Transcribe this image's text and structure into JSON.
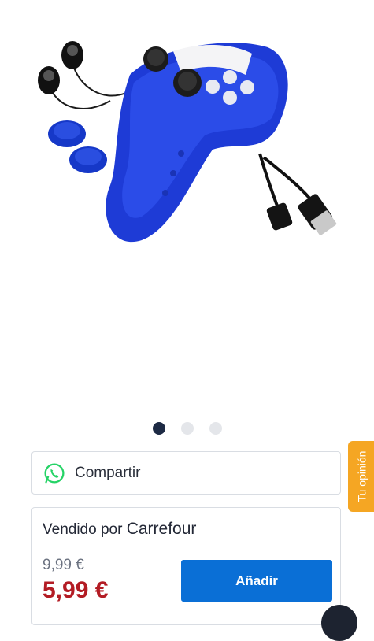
{
  "product": {
    "image_alt": "Mando azul con funda de silicona, auriculares, grips y cable USB"
  },
  "carousel": {
    "count": 3,
    "active_index": 0
  },
  "share": {
    "icon": "whatsapp-icon",
    "label": "Compartir"
  },
  "seller": {
    "prefix": "Vendido por",
    "name": "Carrefour"
  },
  "pricing": {
    "old_price": "9,99 €",
    "new_price": "5,99 €",
    "add_label": "Añadir"
  },
  "feedback": {
    "label": "Tu opinión"
  },
  "colors": {
    "accent": "#0a6fd6",
    "price": "#b31c24",
    "feedback_tab": "#f5a623",
    "dot_active": "#1d2a44",
    "dot_inactive": "#e4e6ea",
    "whatsapp": "#25d366"
  }
}
